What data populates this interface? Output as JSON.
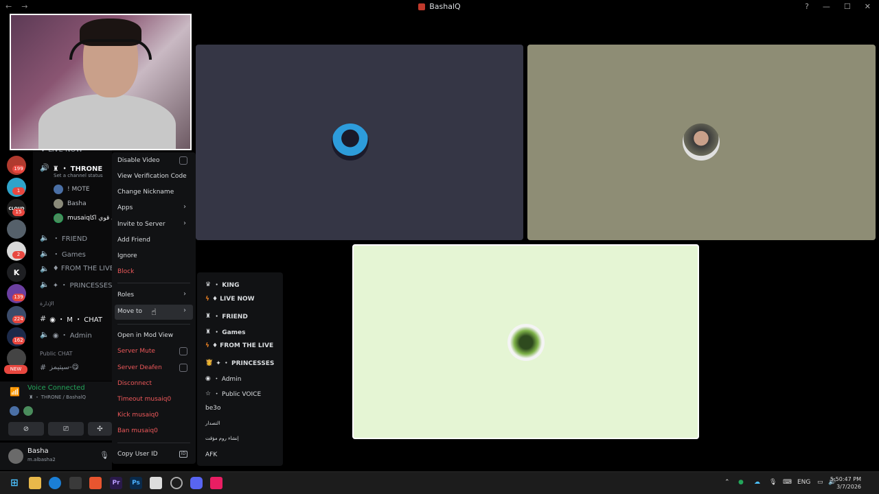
{
  "window": {
    "title": "BashalQ",
    "back": "←",
    "forward": "→",
    "minimize": "—",
    "maximize": "☐",
    "close": "✕",
    "help": "?"
  },
  "rail": {
    "servers": [
      {
        "name": "server-1",
        "badge": "199"
      },
      {
        "name": "server-2",
        "badge": "1"
      },
      {
        "name": "server-cloud",
        "label": "CLOUD",
        "badge": "15"
      },
      {
        "name": "server-4"
      },
      {
        "name": "server-5",
        "badge": "2"
      },
      {
        "name": "server-k",
        "label": "K"
      },
      {
        "name": "server-7",
        "badge": "139"
      },
      {
        "name": "server-8",
        "badge": "224"
      },
      {
        "name": "server-9",
        "badge": "162"
      },
      {
        "name": "server-10",
        "label": "NEW"
      }
    ]
  },
  "channels": {
    "top_partial": "♦ LIVE NOW",
    "throne": "♜ ・ THRONE",
    "throne_status": "Set a channel status",
    "members": [
      "! MOTE",
      "Basha",
      "musaiqـسي قوي اكا"
    ],
    "friend": "・ FRIEND",
    "games": "・ Games",
    "from_live": "♦ FROM THE LIVE",
    "princesses": "✦ ・ PRINCESSES",
    "cat_admin": "الإدارة",
    "chat": "◉ ・ M ・ CHAT",
    "admin": "◉ ・ Admin",
    "cat_public": "Public CHAT",
    "public_chat": "سيتيمز-😋"
  },
  "voice": {
    "status": "Voice Connected",
    "location": "♜ ・ THRONE / BashalQ",
    "btn_video": "⊘",
    "btn_screen": "⎚",
    "btn_activity": "✣"
  },
  "user": {
    "name": "Basha",
    "handle": "m.albasha2",
    "mic": "🎙"
  },
  "context_menu": {
    "disable_video": "Disable Video",
    "view_verification": "View Verification Code",
    "change_nickname": "Change Nickname",
    "apps": "Apps",
    "invite": "Invite to Server",
    "add_friend": "Add Friend",
    "ignore": "Ignore",
    "block": "Block",
    "roles": "Roles",
    "move_to": "Move to",
    "mod_view": "Open in Mod View",
    "server_mute": "Server Mute",
    "server_deafen": "Server Deafen",
    "disconnect": "Disconnect",
    "timeout": "Timeout musaiq0",
    "kick": "Kick musaiq0",
    "ban": "Ban musaiq0",
    "copy_id": "Copy User ID",
    "chevron": "›",
    "id_badge": "ID"
  },
  "move_to_submenu": [
    {
      "icon": "♛",
      "label": "・ KING"
    },
    {
      "icon": "ϟ",
      "label": "♦ LIVE NOW"
    },
    {
      "icon": "♜",
      "label": "・ FRIEND"
    },
    {
      "icon": "♜",
      "label": "・ Games"
    },
    {
      "icon": "ϟ",
      "label": "♦ FROM THE LIVE"
    },
    {
      "icon": "👸",
      "label": "✦ ・ PRINCESSES"
    },
    {
      "icon": "◉",
      "label": "・ Admin"
    },
    {
      "icon": "☆",
      "label": "・ Public VOICE"
    },
    {
      "icon": "",
      "label": "be3o"
    },
    {
      "icon": "",
      "label": "التصدار"
    },
    {
      "icon": "",
      "label": "إنشاء روم مؤقت"
    },
    {
      "icon": "",
      "label": "AFK"
    }
  ],
  "taskbar": {
    "start": "⊞",
    "lang": "ENG",
    "time": "5:50:47 PM",
    "date": "3/7/2026",
    "tray_up": "⌃"
  },
  "colors": {
    "accent_green": "#23a55a",
    "danger": "#f0595b",
    "menu_bg": "#111214"
  }
}
